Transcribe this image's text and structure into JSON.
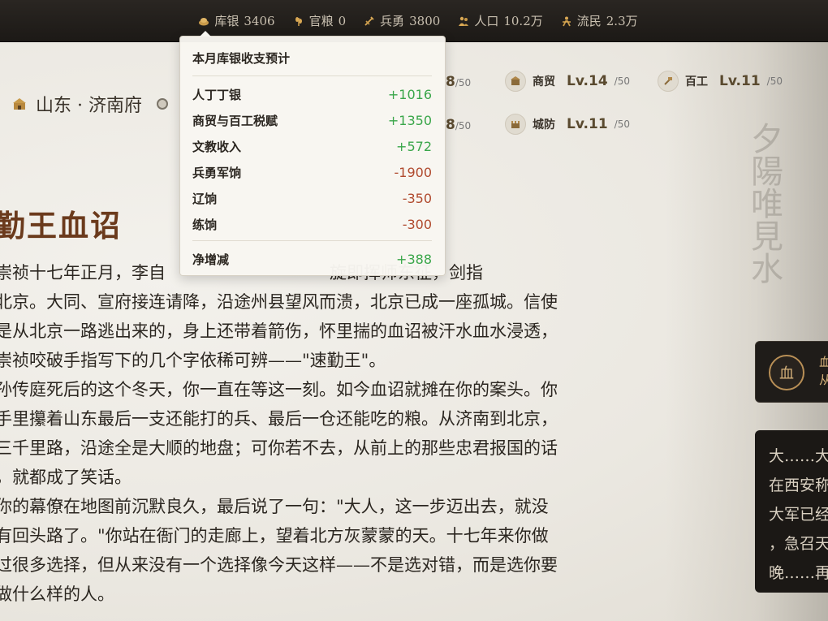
{
  "resources": [
    {
      "icon": "silver-icon",
      "label": "库银",
      "value": "3406"
    },
    {
      "icon": "grain-icon",
      "label": "官粮",
      "value": "0"
    },
    {
      "icon": "soldier-icon",
      "label": "兵勇",
      "value": "3800"
    },
    {
      "icon": "population-icon",
      "label": "人口",
      "value": "10.2万"
    },
    {
      "icon": "refugee-icon",
      "label": "流民",
      "value": "2.3万"
    }
  ],
  "location": {
    "name": "山东 · 济南府"
  },
  "buildings": [
    {
      "icon": "commerce-icon",
      "name": "商贸",
      "level": "Lv.14",
      "max": "/50"
    },
    {
      "icon": "craft-icon",
      "name": "百工",
      "level": "Lv.11",
      "max": "/50"
    },
    {
      "icon": "defense-icon",
      "name": "城防",
      "level": "Lv.11",
      "max": "/50"
    }
  ],
  "hidden_levels": [
    {
      "level": "8",
      "max": "/50"
    },
    {
      "level": "8",
      "max": "/50"
    }
  ],
  "tooltip": {
    "title": "本月库银收支预计",
    "rows": [
      {
        "label": "人丁丁银",
        "value": "+1016",
        "sign": "pos"
      },
      {
        "label": "商贸与百工税赋",
        "value": "+1350",
        "sign": "pos"
      },
      {
        "label": "文教收入",
        "value": "+572",
        "sign": "pos"
      },
      {
        "label": "兵勇军饷",
        "value": "-1900",
        "sign": "neg"
      },
      {
        "label": "辽饷",
        "value": "-350",
        "sign": "neg"
      },
      {
        "label": "练饷",
        "value": "-300",
        "sign": "neg"
      }
    ],
    "total": {
      "label": "净增减",
      "value": "+388",
      "sign": "pos"
    }
  },
  "story": {
    "title": "勤王血诏",
    "lines": [
      "崇祯十七年正月，李自",
      "北京。大同、宣府接连请降，沿途州县望风而溃，北京已成一座孤城。信使",
      "是从北京一路逃出来的，身上还带着箭伤，怀里揣的血诏被汗水血水浸透，",
      "崇祯咬破手指写下的几个字依稀可辨——\"速勤王\"。",
      "孙传庭死后的这个冬天，你一直在等这一刻。如今血诏就摊在你的案头。你",
      "手里攥着山东最后一支还能打的兵、最后一仓还能吃的粮。从济南到北京，",
      "三千里路，沿途全是大顺的地盘；可你若不去，从前上的那些忠君报国的话",
      "，就都成了笑话。",
      "你的幕僚在地图前沉默良久，最后说了一句：\"大人，这一步迈出去，就没",
      "有回头路了。\"你站在衙门的走廊上，望着北方灰蒙蒙的天。十七年来你做",
      "过很多选择，但从来没有一个选择像今天这样——不是选对错，而是选你要",
      "做什么样的人。"
    ],
    "line1_tail": "旋即挥师东征，剑指"
  },
  "side_event": {
    "seal": "血",
    "side_lines": [
      "血",
      "从"
    ],
    "note_lines": [
      "大……大",
      "在西安称",
      "大军已经",
      "，急召天",
      "晚……再"
    ]
  },
  "ink_calligraphy": "夕陽唯見水"
}
